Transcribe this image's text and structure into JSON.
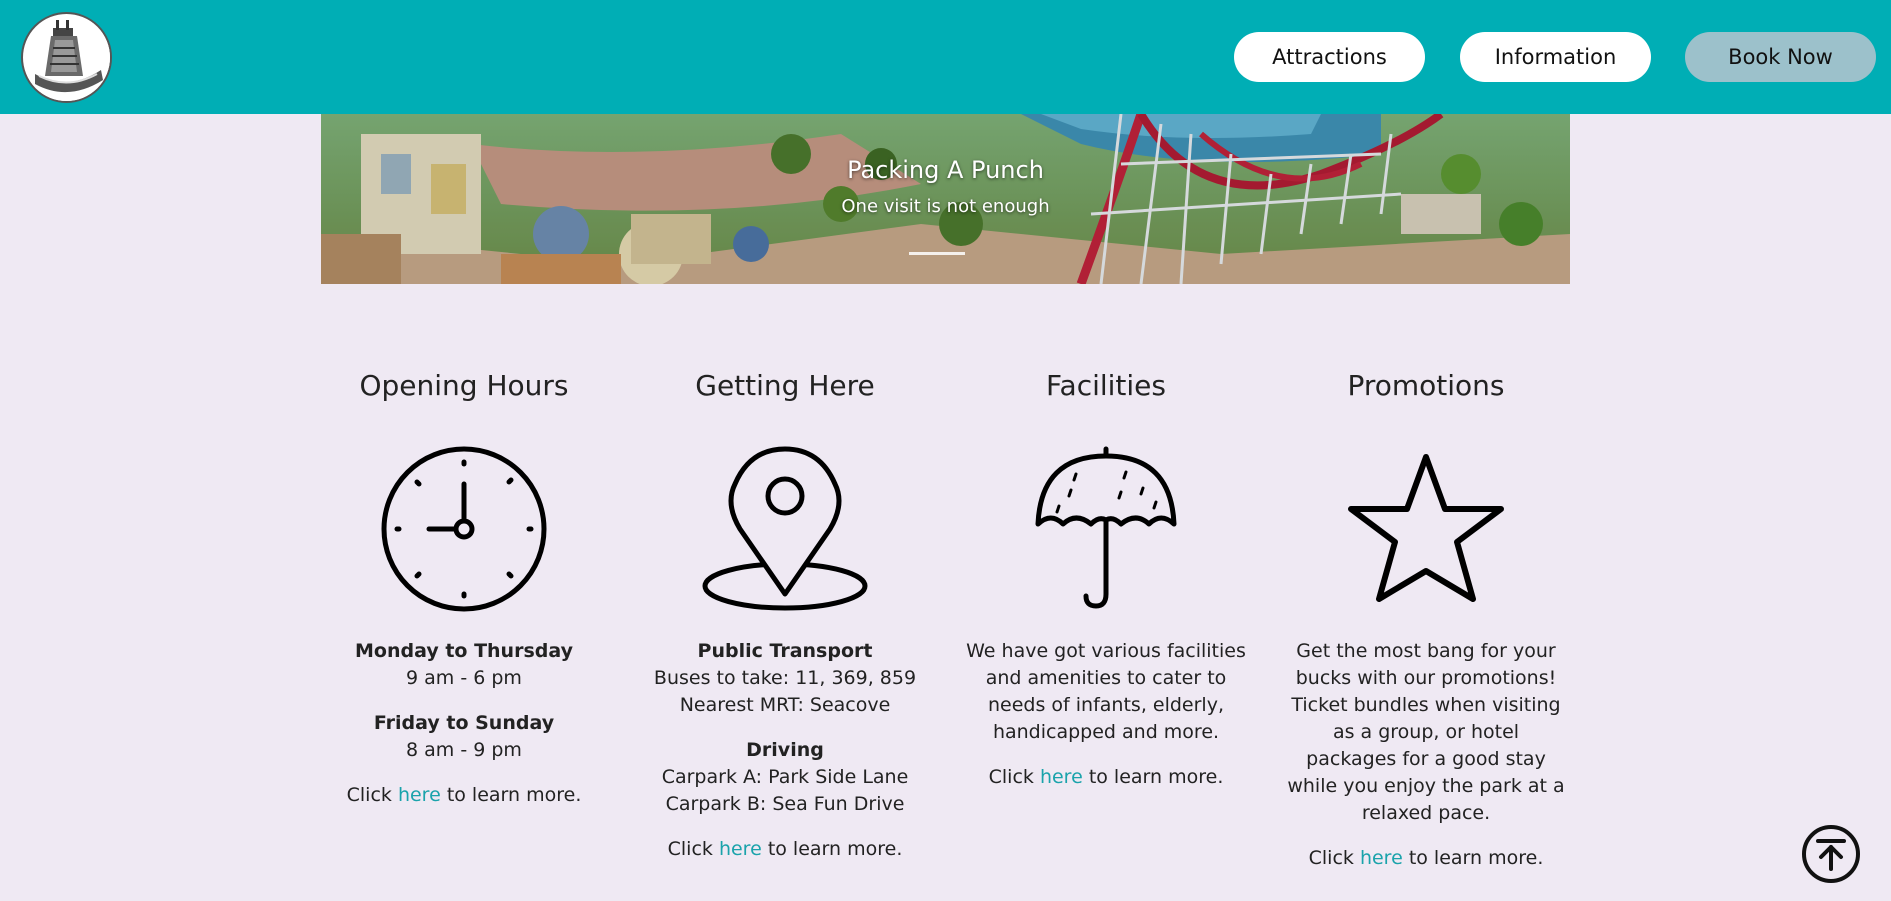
{
  "header": {
    "nav": {
      "attractions": "Attractions",
      "information": "Information",
      "book_now": "Book Now"
    },
    "colors": {
      "bar": "#00aeb5",
      "book_now": "#9cc1cb"
    }
  },
  "banner": {
    "title": "Packing A Punch",
    "subtitle": "One visit is not enough"
  },
  "sections": [
    {
      "title": "Opening Hours",
      "icon": "clock-icon",
      "blocks": [
        {
          "heading": "Monday to Thursday",
          "lines": [
            "9 am - 6 pm"
          ]
        },
        {
          "heading": "Friday to Sunday",
          "lines": [
            "8 am - 9 pm"
          ]
        }
      ],
      "more": {
        "before": "Click ",
        "link": "here",
        "after": " to learn more."
      }
    },
    {
      "title": "Getting Here",
      "icon": "map-pin-icon",
      "blocks": [
        {
          "heading": "Public Transport",
          "lines": [
            "Buses to take: 11, 369, 859",
            "Nearest MRT: Seacove"
          ]
        },
        {
          "heading": "Driving",
          "lines": [
            "Carpark A: Park Side Lane",
            "Carpark B: Sea Fun Drive"
          ]
        }
      ],
      "more": {
        "before": "Click ",
        "link": "here",
        "after": " to learn more."
      }
    },
    {
      "title": "Facilities",
      "icon": "umbrella-icon",
      "text_lines": [
        "We have got various facilities",
        "and amenities to cater to",
        "needs of infants, elderly,",
        "handicapped and more."
      ],
      "more": {
        "before": "Click ",
        "link": "here",
        "after": " to learn more."
      }
    },
    {
      "title": "Promotions",
      "icon": "star-icon",
      "text_lines": [
        "Get the most bang for your",
        "bucks with our promotions!",
        "Ticket bundles when visiting",
        "as a group, or hotel",
        "packages for a good stay",
        "while you enjoy the park at a",
        "relaxed pace."
      ],
      "more": {
        "before": "Click ",
        "link": "here",
        "after": " to learn more."
      }
    }
  ],
  "back_to_top": {
    "icon": "arrow-up-to-top-icon"
  },
  "colors": {
    "page_bg": "#efe9f3",
    "link": "#1aa3ab"
  }
}
